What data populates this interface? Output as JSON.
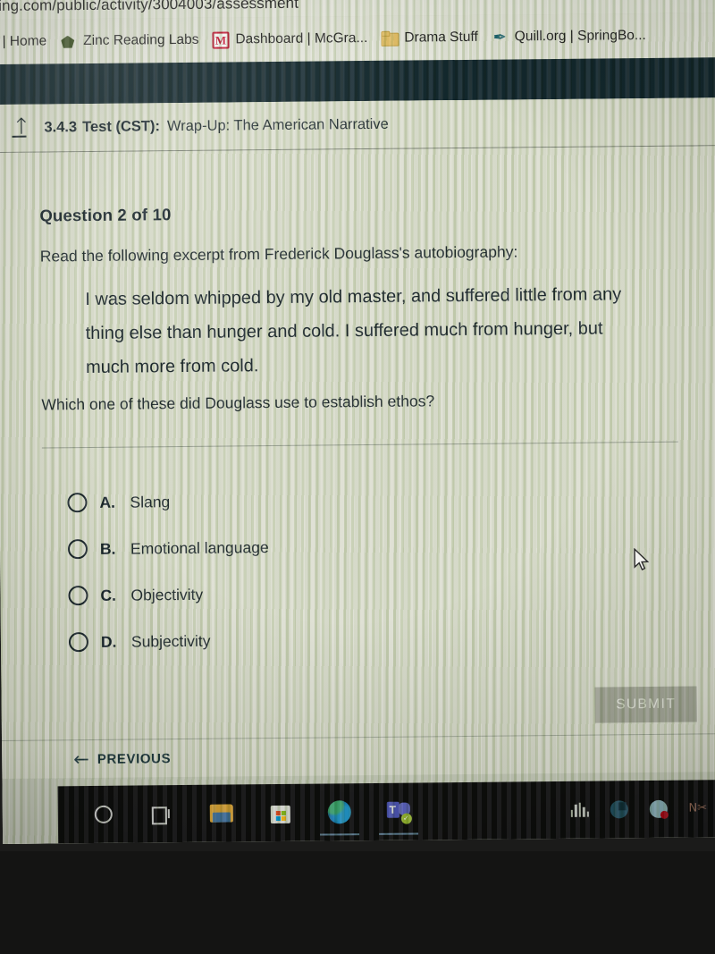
{
  "browser": {
    "url_fragment": "ing.com/public/activity/3004003/assessment",
    "bookmarks": [
      {
        "label": "| Home",
        "icon": "none"
      },
      {
        "label": "Zinc Reading Labs",
        "icon": "pentagon-icon"
      },
      {
        "label": "Dashboard | McGra...",
        "icon": "mcgraw-m-icon"
      },
      {
        "label": "Drama Stuff",
        "icon": "folder-icon"
      },
      {
        "label": "Quill.org | SpringBo...",
        "icon": "quill-pen-icon"
      }
    ]
  },
  "lesson_header": {
    "exit_icon": "exit-up-arrow-icon",
    "code": "3.4.3",
    "kind": "Test (CST):",
    "title": "Wrap-Up: The American Narrative"
  },
  "question": {
    "counter": "Question 2 of 10",
    "intro": "Read the following excerpt from Frederick Douglass's autobiography:",
    "excerpt": "I was seldom whipped by my old master, and suffered little from any thing else than hunger and cold. I suffered much from hunger, but much more from cold.",
    "prompt": "Which one of these did Douglass use to establish ethos?",
    "options": [
      {
        "letter": "A.",
        "text": "Slang",
        "selected": false
      },
      {
        "letter": "B.",
        "text": "Emotional language",
        "selected": false
      },
      {
        "letter": "C.",
        "text": "Objectivity",
        "selected": false
      },
      {
        "letter": "D.",
        "text": "Subjectivity",
        "selected": false
      }
    ]
  },
  "actions": {
    "submit_label": "SUBMIT",
    "submit_enabled": false,
    "previous_label": "PREVIOUS",
    "previous_arrow": "←"
  },
  "taskbar": {
    "left_items": [
      {
        "name": "search-icon",
        "glyph": "circle"
      },
      {
        "name": "task-view-icon",
        "glyph": "taskview"
      },
      {
        "name": "file-explorer-icon",
        "glyph": "explorer"
      },
      {
        "name": "microsoft-store-icon",
        "glyph": "store"
      },
      {
        "name": "microsoft-edge-icon",
        "glyph": "edge"
      },
      {
        "name": "microsoft-teams-icon",
        "glyph": "teams"
      }
    ],
    "tray_items": [
      {
        "name": "audio-equalizer-icon",
        "glyph": "bars"
      },
      {
        "name": "system-tray-circle-icon",
        "glyph": "pie"
      },
      {
        "name": "skype-icon",
        "glyph": "skype",
        "letter": "S"
      },
      {
        "name": "snipping-tool-icon",
        "glyph": "snip",
        "letter": "N"
      }
    ]
  },
  "colors": {
    "screen_bg": "#dfe1d4",
    "nav_band": "#0c2129",
    "submit_disabled": "#a9ab9f",
    "link_teal": "#16323a",
    "text_dark": "#14212a"
  }
}
